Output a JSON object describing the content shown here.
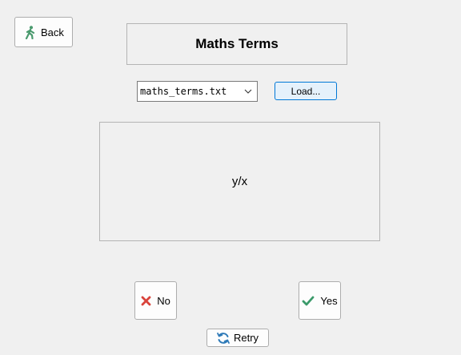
{
  "buttons": {
    "back": {
      "label": "Back",
      "icon": "walking-person-icon",
      "icon_color": "#4a9a6e"
    },
    "load": {
      "label": "Load..."
    },
    "no": {
      "label": "No",
      "icon": "x-mark-icon",
      "icon_color": "#d9433b"
    },
    "yes": {
      "label": "Yes",
      "icon": "check-mark-icon",
      "icon_color": "#3b9a6a"
    },
    "retry": {
      "label": "Retry",
      "icon": "refresh-icon",
      "icon_color": "#2e7ab8"
    }
  },
  "title": "Maths Terms",
  "file_select": {
    "selected": "maths_terms.txt"
  },
  "term": {
    "text": "y/x"
  }
}
